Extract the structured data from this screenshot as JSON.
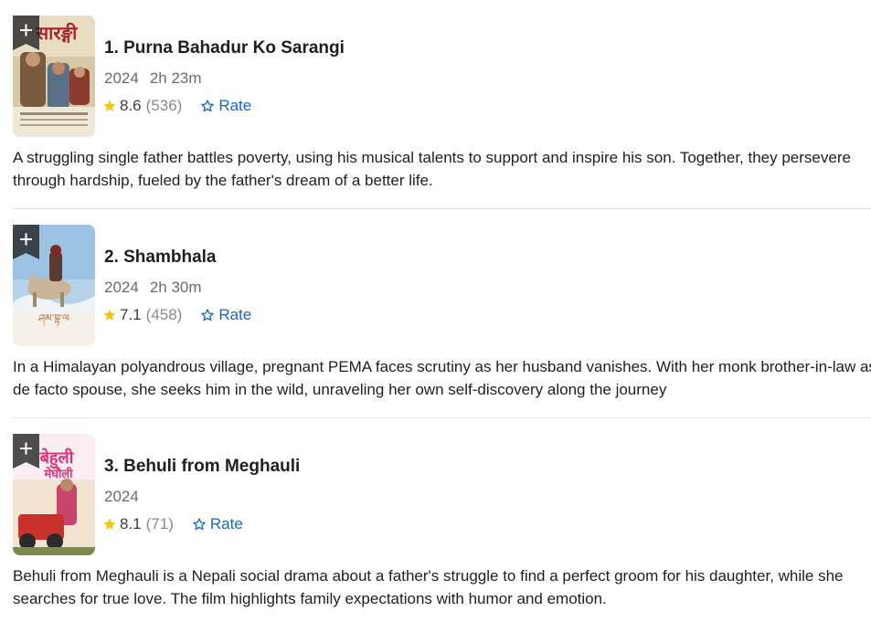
{
  "titles": [
    {
      "title": "1. Purna Bahadur Ko Sarangi",
      "year": "2024",
      "runtime": "2h 23m",
      "rating": "8.6",
      "votes": "(536)",
      "rate_label": "Rate",
      "description_line1": "A struggling single father battles poverty, using his musical talents to support and inspire his son. Together, they persevere",
      "description_line2": "through hardship, fueled by the father's dream of a better life.",
      "poster_icon": "movie-poster"
    },
    {
      "title": "2. Shambhala",
      "year": "2024",
      "runtime": "2h 30m",
      "rating": "7.1",
      "votes": "(458)",
      "rate_label": "Rate",
      "description_line1": "In a Himalayan polyandrous village, pregnant PEMA faces scrutiny as her husband vanishes. With her monk brother-in-law as",
      "description_line2": "de facto spouse, she seeks him in the wild, unraveling her own self-discovery along the journey",
      "poster_icon": "movie-poster"
    },
    {
      "title": "3. Behuli from Meghauli",
      "year": "2024",
      "runtime": "",
      "rating": "8.1",
      "votes": "(71)",
      "rate_label": "Rate",
      "description_line1": "Behuli from Meghauli is a Nepali social drama about a father's struggle to find a perfect groom for his daughter, while she",
      "description_line2": "searches for true love. The film highlights family expectations with humor and emotion.",
      "poster_icon": "movie-poster"
    }
  ],
  "icons": {
    "add": "plus-icon",
    "rating_star": "star-filled-icon",
    "rate_star": "star-outline-icon"
  },
  "colors": {
    "star": "#f5c518",
    "link": "#1767c4",
    "title": "#1f1f1f",
    "meta": "#6b6b6b"
  }
}
